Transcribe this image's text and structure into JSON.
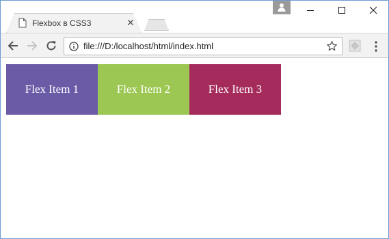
{
  "window": {
    "tab": {
      "title": "Flexbox в CSS3",
      "close_glyph": "✕"
    },
    "controls": {
      "minimize": "—",
      "maximize": "☐",
      "close": "✕"
    }
  },
  "toolbar": {
    "address": {
      "url": "file:///D:/localhost/html/index.html"
    },
    "icons": [
      "back-arrow-icon",
      "forward-arrow-icon",
      "reload-icon",
      "info-icon",
      "star-icon",
      "extension-icon",
      "menu-icon"
    ]
  },
  "page": {
    "flex_items": [
      {
        "label": "Flex Item 1",
        "color": "#6b5ba7"
      },
      {
        "label": "Flex Item 2",
        "color": "#9bc752"
      },
      {
        "label": "Flex Item 3",
        "color": "#a52b5c"
      }
    ]
  }
}
